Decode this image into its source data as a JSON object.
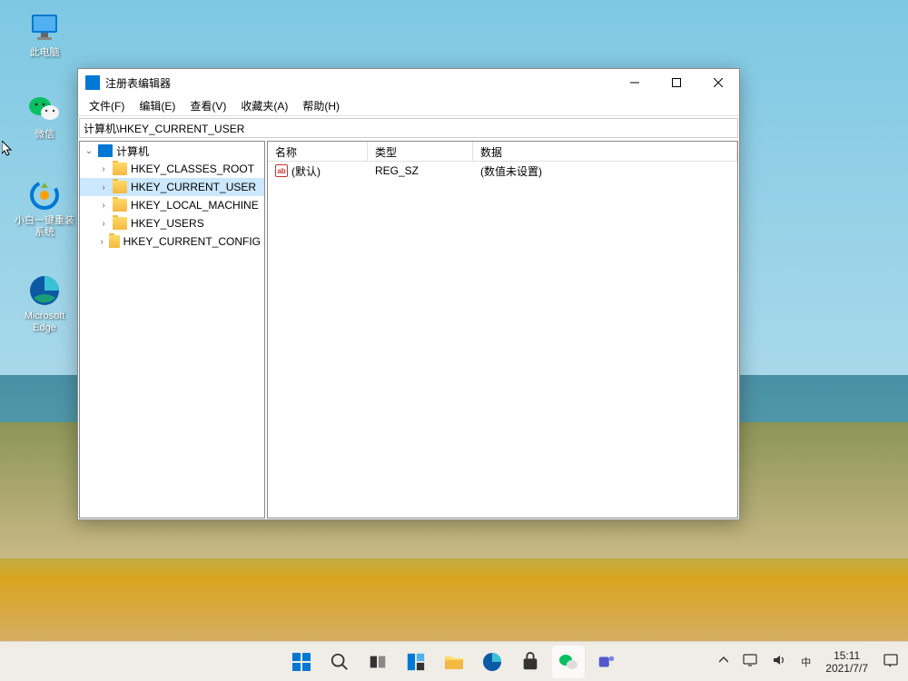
{
  "desktop": {
    "icons": [
      {
        "label": "此电脑"
      },
      {
        "label": "微信"
      },
      {
        "label": "小白一键重装系统"
      },
      {
        "label": "Microsoft Edge"
      }
    ]
  },
  "window": {
    "title": "注册表编辑器",
    "menu": [
      "文件(F)",
      "编辑(E)",
      "查看(V)",
      "收藏夹(A)",
      "帮助(H)"
    ],
    "address": "计算机\\HKEY_CURRENT_USER",
    "tree": {
      "root": "计算机",
      "children": [
        {
          "name": "HKEY_CLASSES_ROOT",
          "selected": false
        },
        {
          "name": "HKEY_CURRENT_USER",
          "selected": true
        },
        {
          "name": "HKEY_LOCAL_MACHINE",
          "selected": false
        },
        {
          "name": "HKEY_USERS",
          "selected": false
        },
        {
          "name": "HKEY_CURRENT_CONFIG",
          "selected": false
        }
      ]
    },
    "list": {
      "headers": {
        "name": "名称",
        "type": "类型",
        "data": "数据"
      },
      "rows": [
        {
          "name": "(默认)",
          "type": "REG_SZ",
          "data": "(数值未设置)"
        }
      ]
    }
  },
  "taskbar": {
    "tray": {
      "ime": "中",
      "time": "15:11",
      "date": "2021/7/7"
    }
  }
}
